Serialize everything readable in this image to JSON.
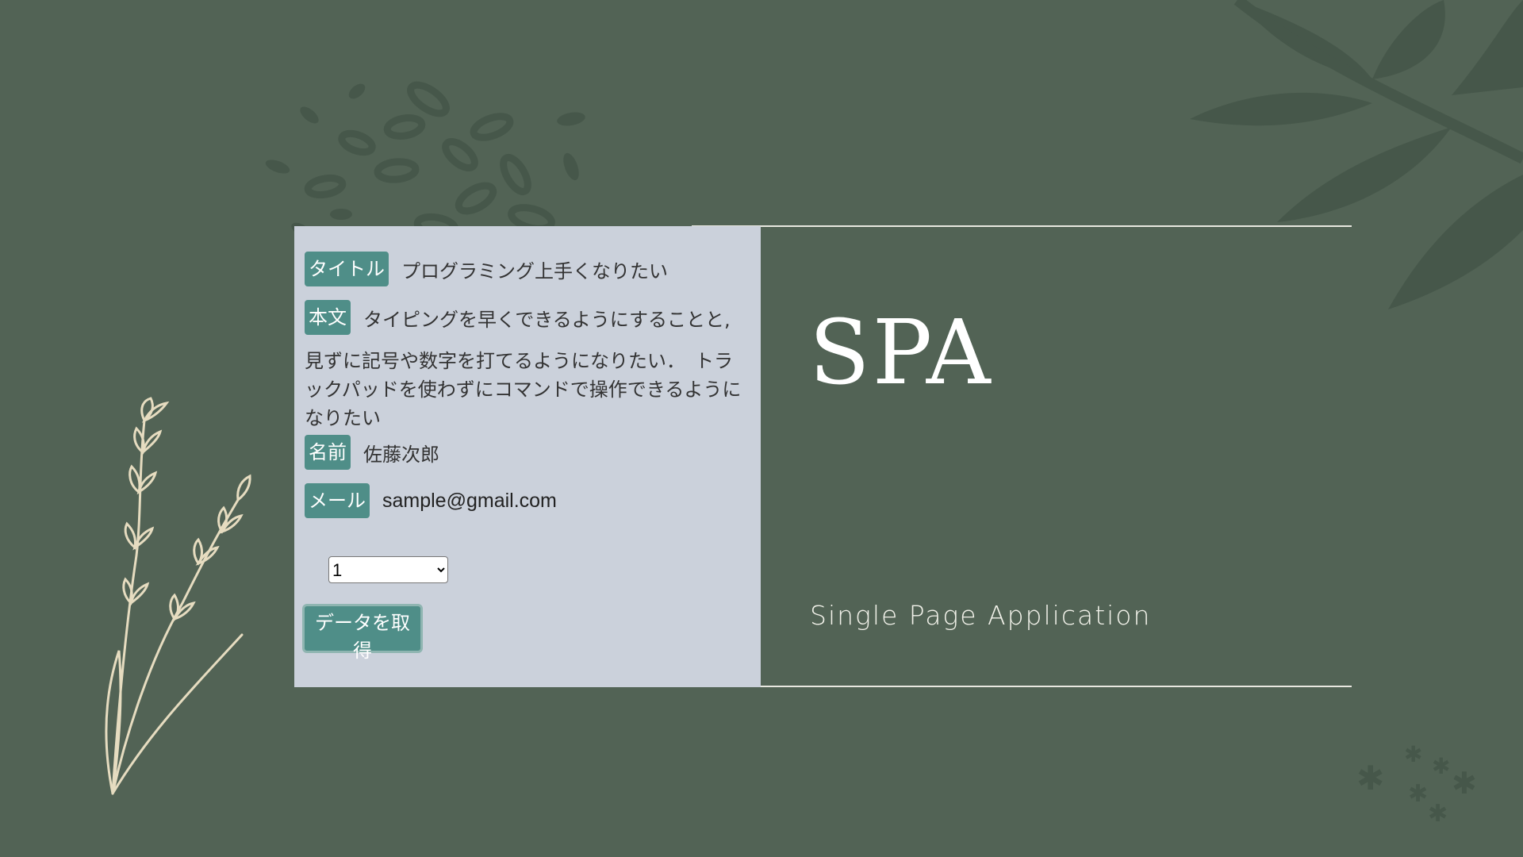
{
  "record": {
    "title_label": "タイトル",
    "title_value": "プログラミング上手くなりたい",
    "body_label": "本文",
    "body_first_line": "タイピングを早くできるようにすることと,",
    "body_rest": "見ずに記号や数字を打てるようになりたい．　トラックパッドを使わずにコマンドで操作できるようになりたい",
    "name_label": "名前",
    "name_value": "佐藤次郎",
    "email_label": "メール",
    "email_value": "sample@gmail.com"
  },
  "controls": {
    "select_value": "1",
    "fetch_button_label": "データを取得"
  },
  "hero": {
    "title": "SPA",
    "subtitle": "Single Page Application"
  },
  "colors": {
    "background": "#526355",
    "panel": "#cbd1db",
    "accent": "#4f8e88",
    "decoration_dark": "#46574a",
    "decoration_light": "#e6dcc0"
  },
  "icons": [
    "leaf-cluster-icon",
    "large-leaf-icon",
    "plant-sprig-icon",
    "star-scatter-icon"
  ]
}
